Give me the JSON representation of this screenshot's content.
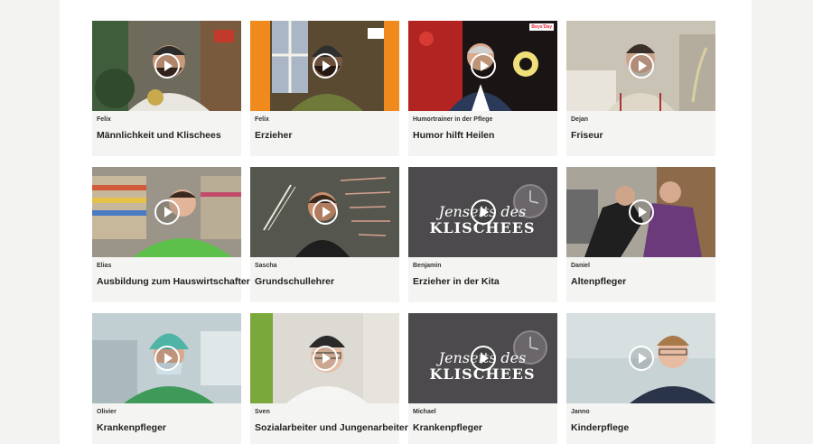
{
  "videos": [
    {
      "label": "Felix",
      "title": "Männlichkeit und Klischees",
      "thumbnail": "man-with-cap-and-beard"
    },
    {
      "label": "Felix",
      "title": "Erzieher",
      "thumbnail": "man-with-beanie-window"
    },
    {
      "label": "Humortrainer in der Pflege",
      "title": "Humor hilft Heilen",
      "thumbnail": "man-red-background"
    },
    {
      "label": "Dejan",
      "title": "Friseur",
      "thumbnail": "man-bedroom"
    },
    {
      "label": "Elias",
      "title": "Ausbildung zum Hauswirtschafter",
      "thumbnail": "man-green-shirt-shelves"
    },
    {
      "label": "Sascha",
      "title": "Grundschullehrer",
      "thumbnail": "man-chalkboard"
    },
    {
      "label": "Benjamin",
      "title": "Erzieher in der Kita",
      "thumbnail": "jenseits-des-klischees-logo"
    },
    {
      "label": "Daniel",
      "title": "Altenpfleger",
      "thumbnail": "caregiver-with-elderly"
    },
    {
      "label": "Olivier",
      "title": "Krankenpfleger",
      "thumbnail": "man-surgical-cap"
    },
    {
      "label": "Sven",
      "title": "Sozialarbeiter und Jungenarbeiter",
      "thumbnail": "man-cap-glasses"
    },
    {
      "label": "Michael",
      "title": "Krankenpfleger",
      "thumbnail": "jenseits-des-klischees-logo"
    },
    {
      "label": "Janno",
      "title": "Kinderpflege",
      "thumbnail": "young-man-glasses"
    }
  ],
  "logo": {
    "line1": "Jenseits des",
    "line2": "KLISCHEES"
  },
  "badge": {
    "text": "Boys'Day"
  },
  "colors": {
    "card_bg": "#f4f4f2",
    "play_icon": "#ffffff"
  }
}
